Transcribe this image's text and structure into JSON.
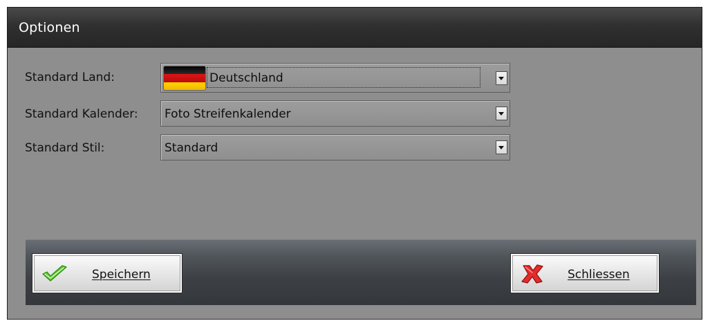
{
  "window": {
    "title": "Optionen"
  },
  "form": {
    "country": {
      "label": "Standard Land:",
      "value": "Deutschland",
      "flag_icon": "germany-flag-icon"
    },
    "calendar": {
      "label": "Standard Kalender:",
      "value": "Foto Streifenkalender"
    },
    "style": {
      "label": "Standard Stil:",
      "value": "Standard"
    }
  },
  "buttons": {
    "save": {
      "label": "Speichern",
      "icon": "checkmark-icon",
      "icon_color": "#4fbf2a"
    },
    "close": {
      "label": "Schliessen",
      "icon": "x-cross-icon",
      "icon_color": "#e02a2a"
    }
  },
  "colors": {
    "titlebar": "#303030",
    "panel": "#8e8e8e",
    "button_bar": "#44484d"
  }
}
